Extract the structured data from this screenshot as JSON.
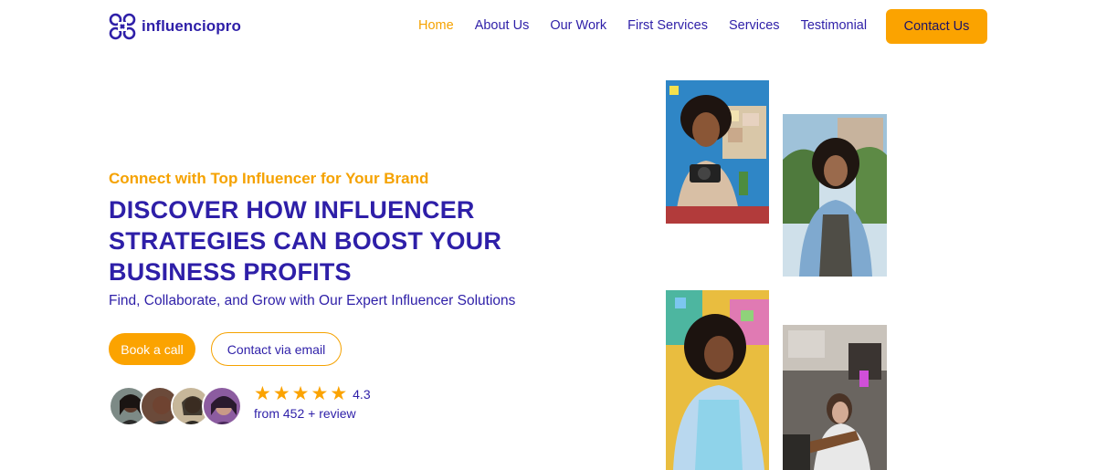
{
  "brand": {
    "name": "influenciopro",
    "logo_icon": "clover-logo-icon"
  },
  "nav": {
    "items": [
      {
        "label": "Home",
        "active": true
      },
      {
        "label": "About Us",
        "active": false
      },
      {
        "label": "Our Work",
        "active": false
      },
      {
        "label": "First Services",
        "active": false
      },
      {
        "label": "Services",
        "active": false
      },
      {
        "label": "Testimonial",
        "active": false
      }
    ],
    "contact_label": "Contact Us"
  },
  "hero": {
    "tagline": "Connect with Top Influencer for Your Brand",
    "headline": "DISCOVER HOW INFLUENCER STRATEGIES CAN BOOST YOUR BUSINESS PROFITS",
    "subheadline": "Find, Collaborate, and Grow with Our Expert Influencer Solutions",
    "primary_cta": "Book a call",
    "secondary_cta": "Contact via email"
  },
  "social_proof": {
    "stars": 5,
    "rating": "4.3",
    "reviews_text": "from 452 + review"
  },
  "colors": {
    "brand_blue": "#2e1fa8",
    "accent_orange": "#fba300",
    "background": "#ffffff"
  }
}
